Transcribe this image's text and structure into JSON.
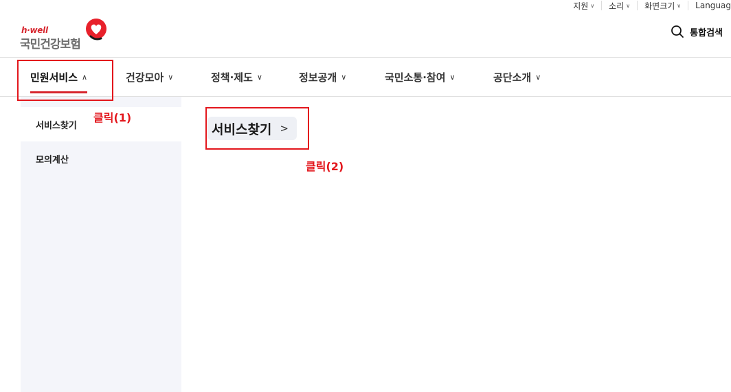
{
  "util_bar": {
    "items": [
      {
        "label": "지원"
      },
      {
        "label": "소리"
      },
      {
        "label": "화면크기"
      },
      {
        "label": "Languag"
      }
    ]
  },
  "logo": {
    "tagline": "h·well",
    "name": "국민건강보험",
    "brand_color": "#d7262e"
  },
  "search": {
    "label": "통합검색",
    "icon": "search-icon"
  },
  "gnb": {
    "items": [
      {
        "label": "민원서비스",
        "chevron": "∧",
        "active": true
      },
      {
        "label": "건강모아",
        "chevron": "∨"
      },
      {
        "label": "정책·제도",
        "chevron": "∨"
      },
      {
        "label": "정보공개",
        "chevron": "∨"
      },
      {
        "label": "국민소통·참여",
        "chevron": "∨"
      },
      {
        "label": "공단소개",
        "chevron": "∨"
      }
    ]
  },
  "sidebar": {
    "items": [
      {
        "label": "서비스찾기",
        "active": true
      },
      {
        "label": "모의계산"
      }
    ]
  },
  "main": {
    "link_label": "서비스찾기",
    "link_arrow": ">"
  },
  "annotations": {
    "step1": "클릭(1)",
    "step2": "클릭(2)",
    "color": "#e3161c"
  }
}
